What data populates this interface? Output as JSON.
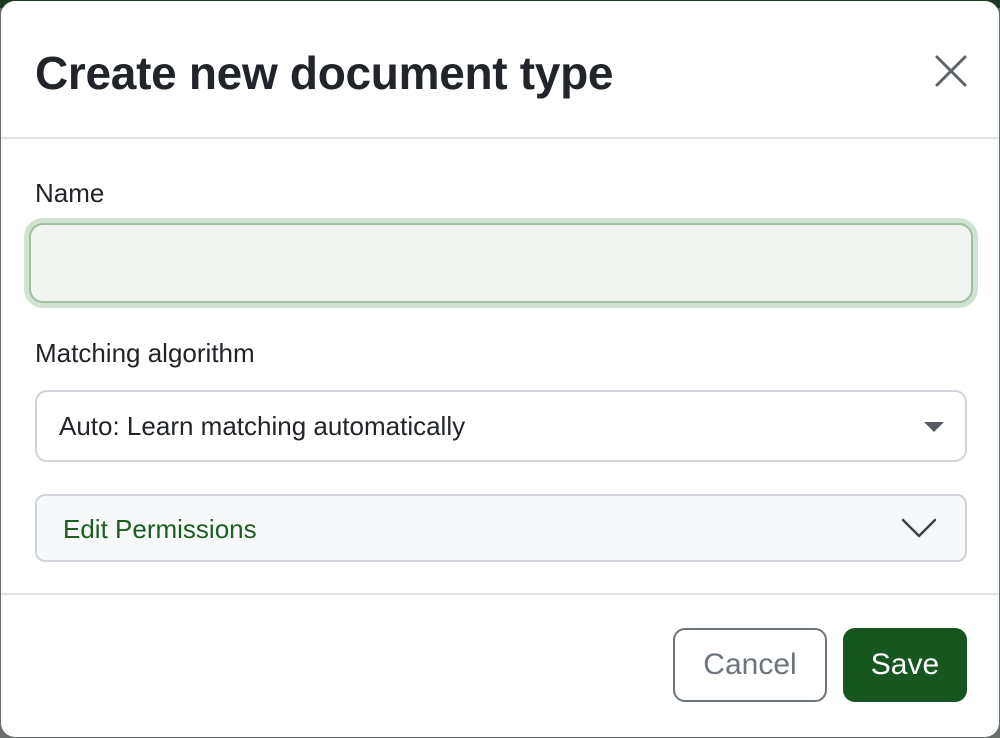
{
  "colors": {
    "accent": "#17561e",
    "accent_text": "#1b5e20",
    "border": "#ced4da",
    "secondary": "#6c757d"
  },
  "dialog": {
    "title": "Create new document type",
    "close_icon": "close-icon"
  },
  "form": {
    "name": {
      "label": "Name",
      "value": "",
      "placeholder": ""
    },
    "matching": {
      "label": "Matching algorithm",
      "selected": "Auto: Learn matching automatically",
      "icon": "caret-down-icon"
    },
    "permissions": {
      "label": "Edit Permissions",
      "icon": "chevron-down-icon"
    }
  },
  "footer": {
    "cancel_label": "Cancel",
    "save_label": "Save"
  }
}
